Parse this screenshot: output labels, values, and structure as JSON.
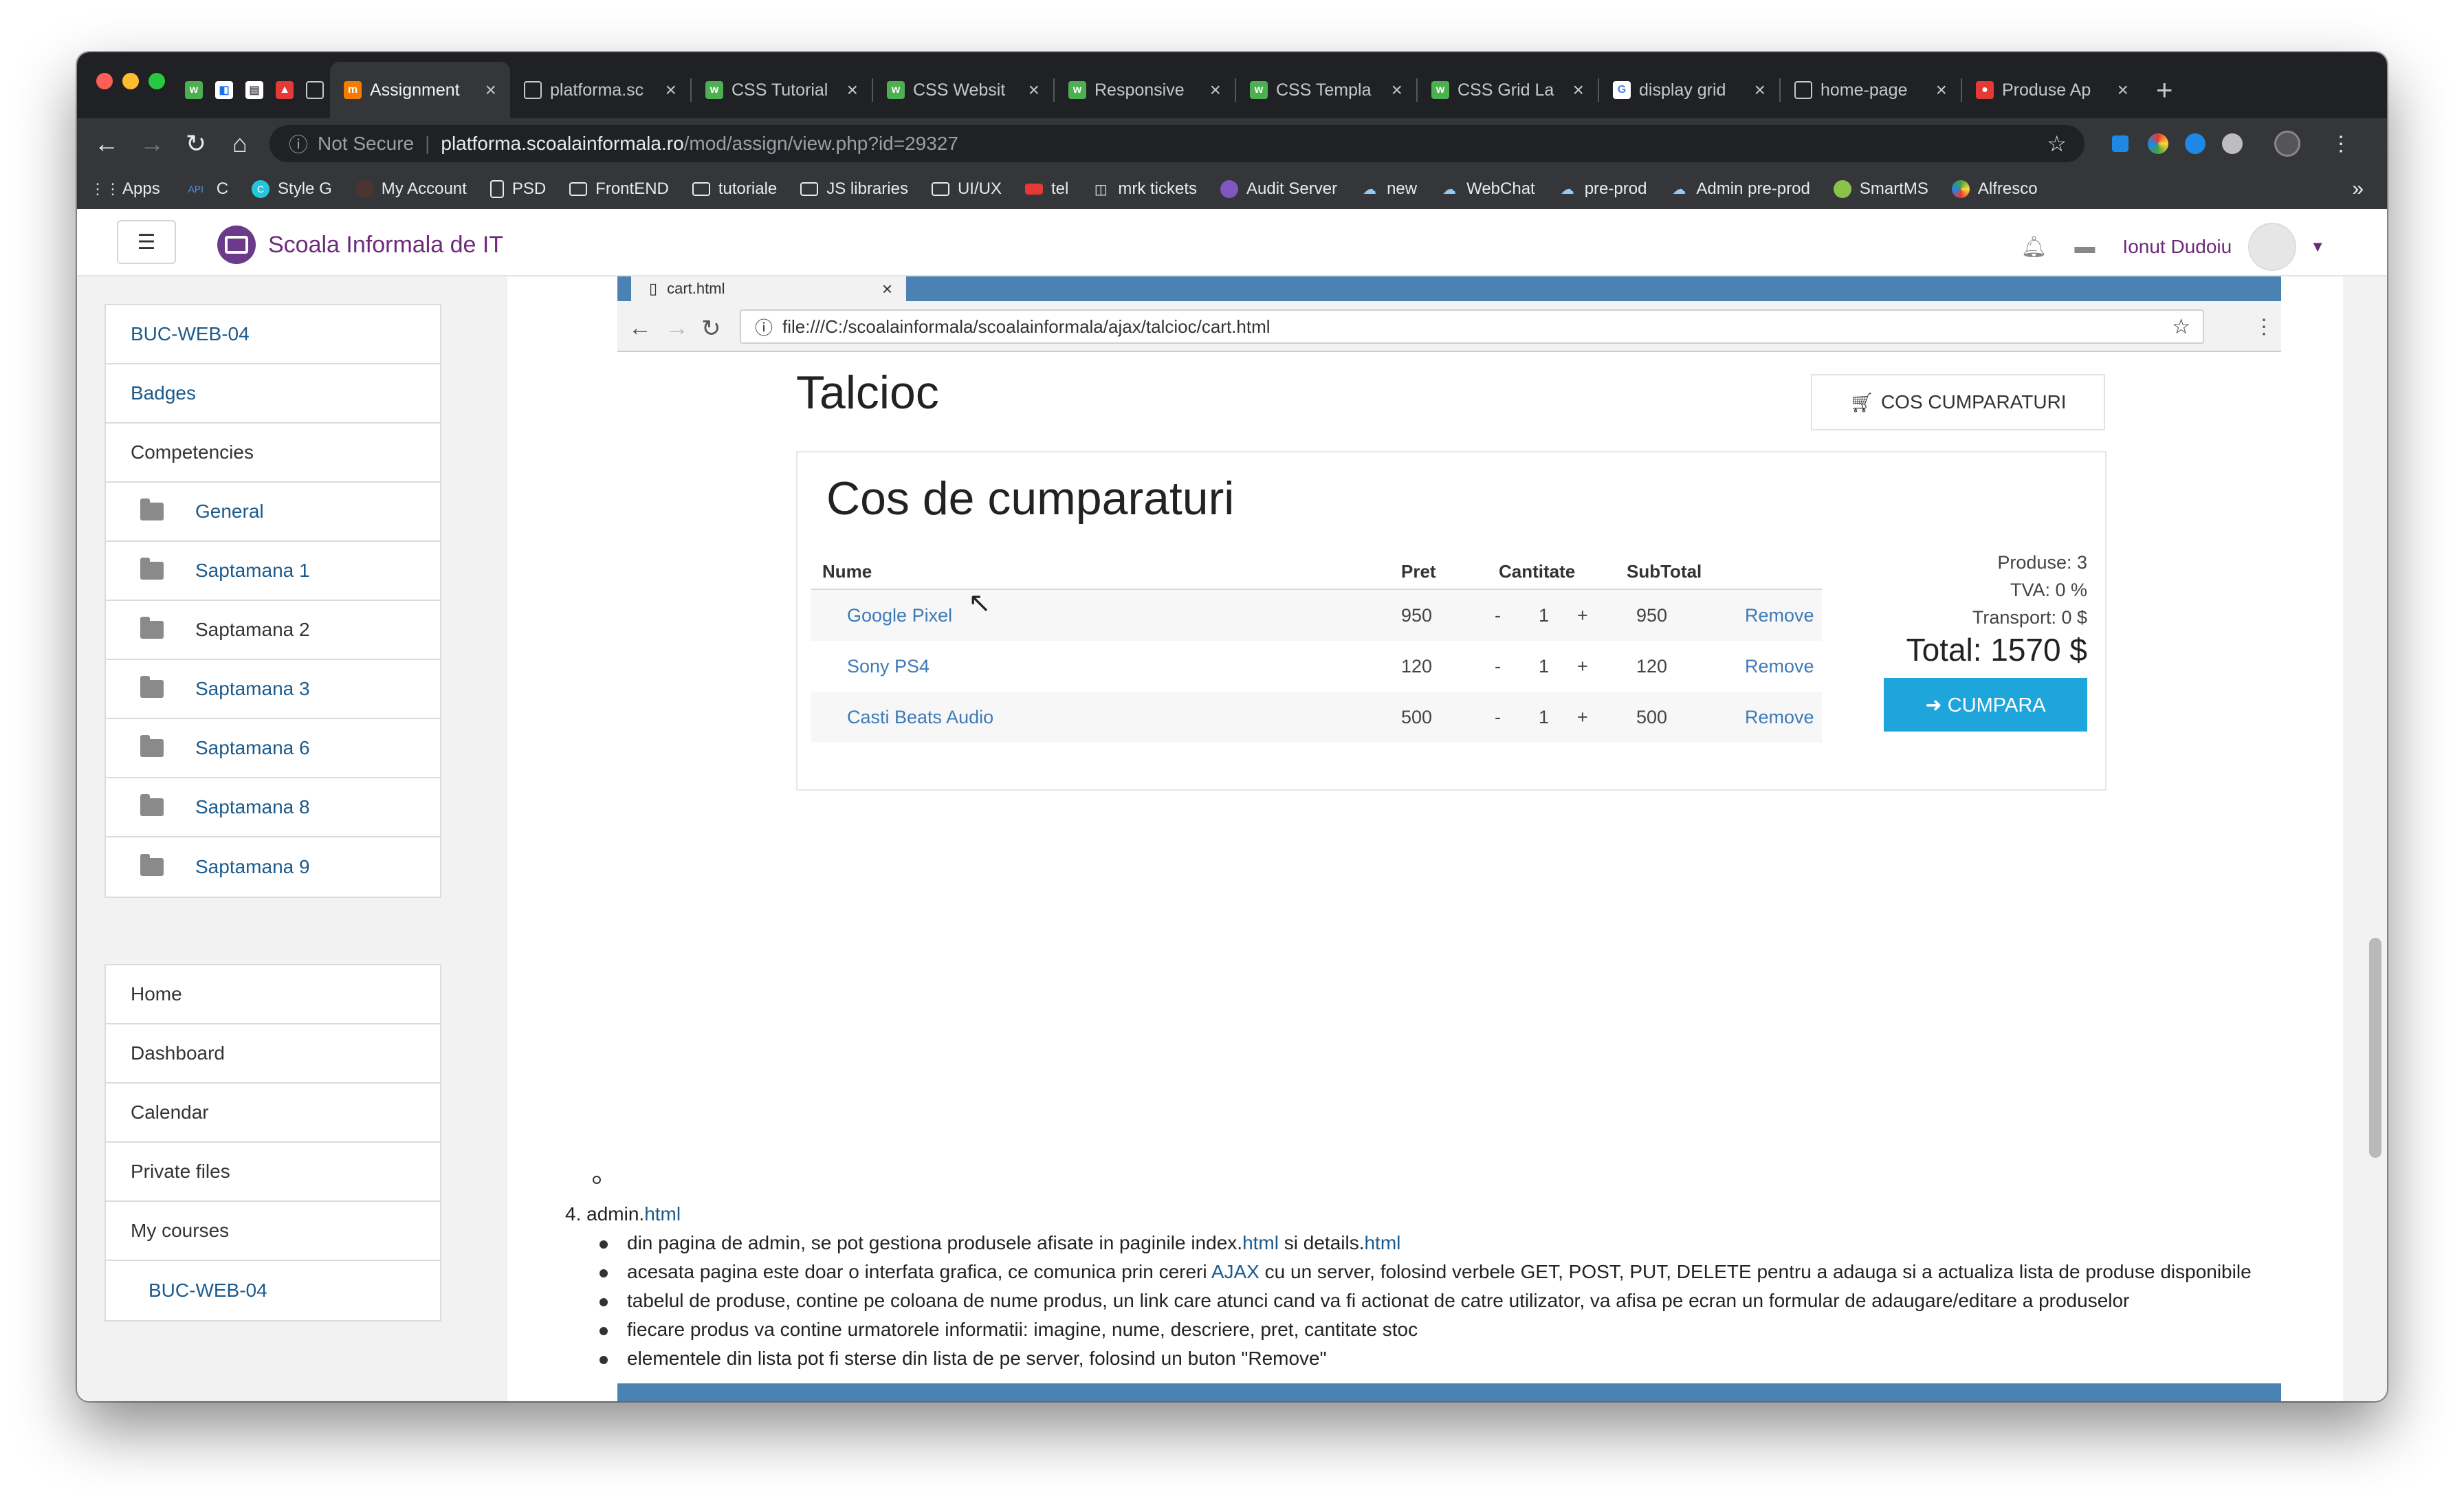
{
  "browser": {
    "tabs": [
      {
        "title": "Assignment",
        "active": true
      },
      {
        "title": "platforma.sc"
      },
      {
        "title": "CSS Tutorial"
      },
      {
        "title": "CSS Websit"
      },
      {
        "title": "Responsive"
      },
      {
        "title": "CSS Templa"
      },
      {
        "title": "CSS Grid La"
      },
      {
        "title": "display grid"
      },
      {
        "title": "home-page"
      },
      {
        "title": "Produse Ap"
      }
    ],
    "security_label": "Not Secure",
    "url_host": "platforma.scoalainformala.ro",
    "url_path": "/mod/assign/view.php?id=29327",
    "bookmarks": [
      "Apps",
      "C",
      "Style G",
      "My Account",
      "PSD",
      "FrontEND",
      "tutoriale",
      "JS libraries",
      "UI/UX",
      "tel",
      "mrk tickets",
      "Audit Server",
      "new",
      "WebChat",
      "pre-prod",
      "Admin pre-prod",
      "SmartMS",
      "Alfresco"
    ],
    "bookmark_prefix_api": "API",
    "more": "»"
  },
  "header": {
    "brand": "Scoala Informala de IT",
    "user": "Ionut Dudoiu"
  },
  "sidebar": {
    "course": "BUC-WEB-04",
    "items": [
      "Badges",
      "Competencies",
      "General",
      "Saptamana 1",
      "Saptamana 2",
      "Saptamana 3",
      "Saptamana 6",
      "Saptamana 8",
      "Saptamana 9"
    ],
    "nav": [
      "Home",
      "Dashboard",
      "Calendar",
      "Private files",
      "My courses"
    ],
    "my_course": "BUC-WEB-04"
  },
  "screenshot": {
    "tab_title": "cart.html",
    "url": "file:///C:/scoalainformala/scoalainformala/ajax/talcioc/cart.html",
    "site_title": "Talcioc",
    "cart_button": "COS CUMPARATURI",
    "heading": "Cos de cumparaturi",
    "columns": [
      "Nume",
      "Pret",
      "Cantitate",
      "SubTotal"
    ],
    "rows": [
      {
        "name": "Google Pixel",
        "price": "950",
        "qty": "1",
        "subtotal": "950",
        "remove": "Remove"
      },
      {
        "name": "Sony PS4",
        "price": "120",
        "qty": "1",
        "subtotal": "120",
        "remove": "Remove"
      },
      {
        "name": "Casti Beats Audio",
        "price": "500",
        "qty": "1",
        "subtotal": "500",
        "remove": "Remove"
      }
    ],
    "minus": "-",
    "plus": "+",
    "produse": "Produse: 3",
    "tva": "TVA: 0 %",
    "transport": "Transport: 0 $",
    "total": "Total: 1570 $",
    "buy": "➜ CUMPARA"
  },
  "assignment": {
    "item_number": "4.",
    "item_prefix": "admin.",
    "item_link": "html",
    "bullets": [
      {
        "a": "din pagina de admin, se pot gestiona produsele afisate in paginile index.",
        "l1": "html",
        "b": " si details.",
        "l2": "html"
      },
      {
        "a": "acesata pagina este doar o interfata grafica, ce comunica prin cereri ",
        "l1": "AJAX",
        "b": " cu un server, folosind verbele GET, POST, PUT, DELETE pentru a adauga si a actualiza lista de produse disponibile"
      },
      {
        "a": "tabelul de produse, contine pe coloana de nume produs, un link care atunci cand va fi actionat de catre utilizator, va afisa pe ecran un formular de adaugare/editare a produselor"
      },
      {
        "a": "fiecare produs va contine urmatorele informatii: imagine, nume, descriere, pret, cantitate stoc"
      },
      {
        "a": "elementele din lista pot fi sterse din lista de pe server, folosind un buton \"Remove\""
      }
    ]
  }
}
